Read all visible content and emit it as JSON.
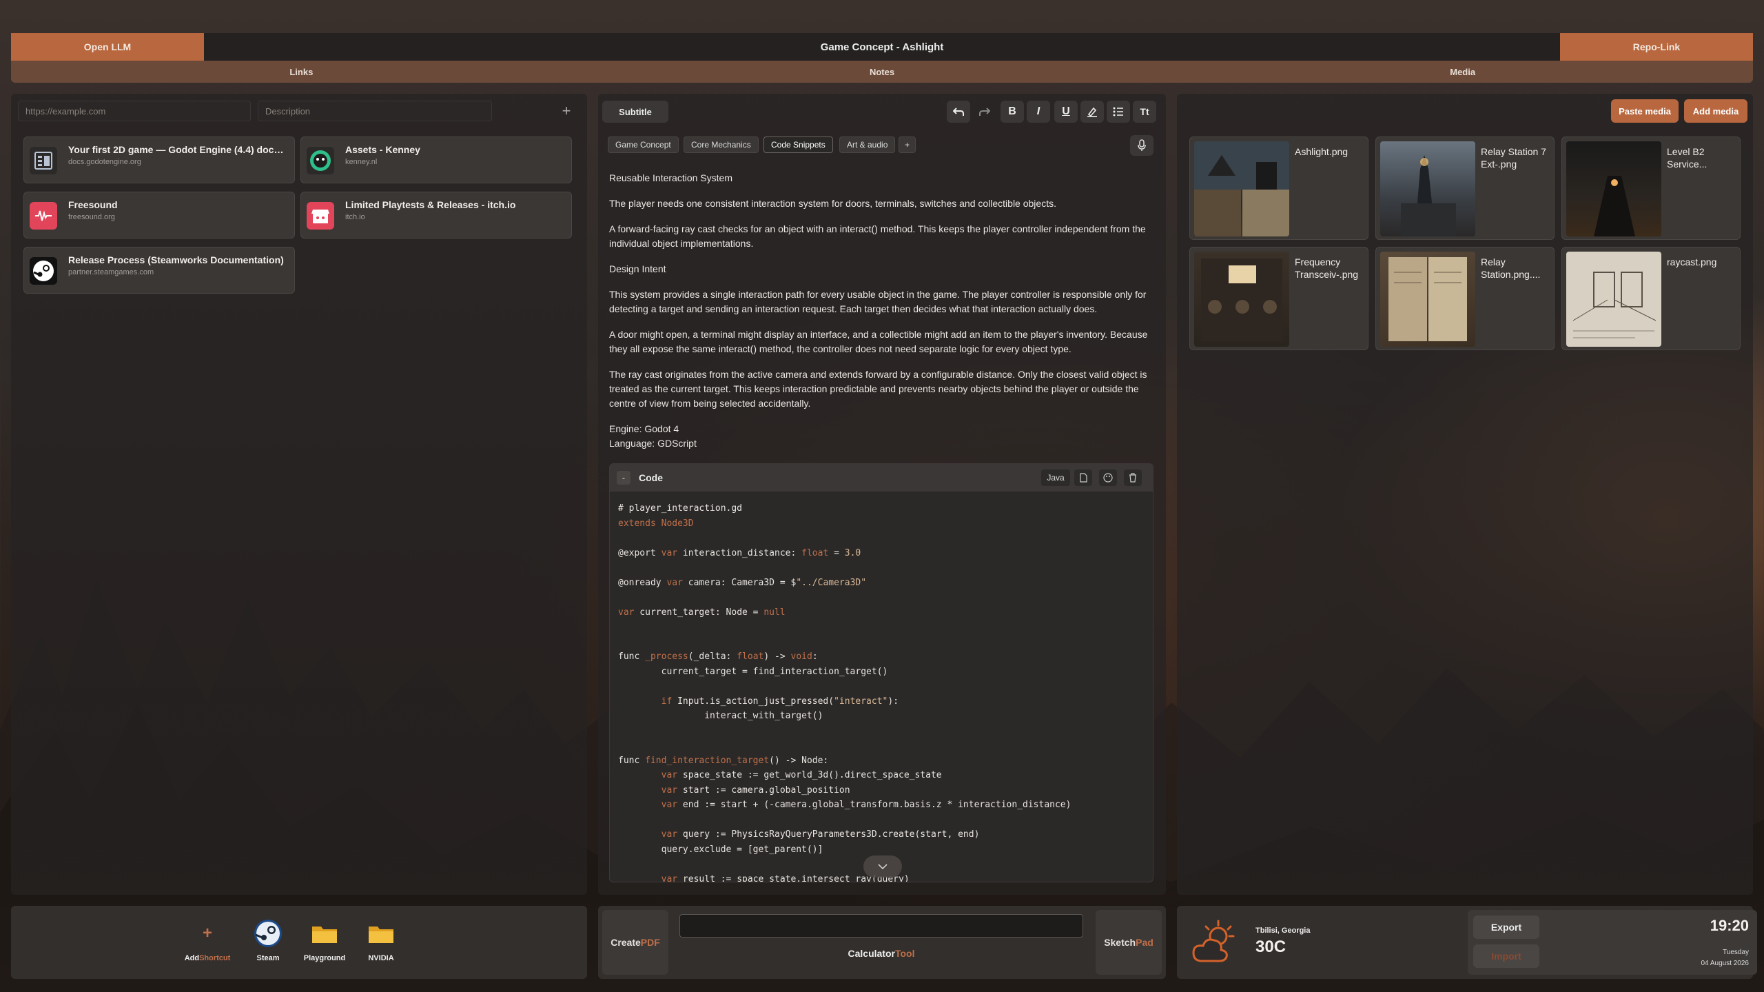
{
  "topbar": {
    "left_button": "Open LLM",
    "title": "Game Concept - Ashlight",
    "right_button": "Repo-Link"
  },
  "sections": {
    "links": "Links",
    "notes": "Notes",
    "media": "Media"
  },
  "links_panel": {
    "url_placeholder": "https://example.com",
    "description_placeholder": "Description",
    "cards": [
      {
        "title": "Your first 2D game — Godot Engine (4.4) docum...",
        "domain": "docs.godotengine.org"
      },
      {
        "title": "Assets - Kenney",
        "domain": "kenney.nl"
      },
      {
        "title": "Freesound",
        "domain": "freesound.org"
      },
      {
        "title": "Limited Playtests & Releases - itch.io",
        "domain": "itch.io"
      },
      {
        "title": "Release Process (Steamworks Documentation)",
        "domain": "partner.steamgames.com"
      }
    ]
  },
  "notes_panel": {
    "style_select": "Subtitle",
    "toolbar": {
      "bold": "B",
      "italic": "I",
      "underline": "U",
      "text_size": "Tt"
    },
    "tags": [
      "Game Concept",
      "Core Mechanics",
      "Code Snippets",
      "Art & audio"
    ],
    "add_tag": "+",
    "active_tag": "Code Snippets",
    "paragraphs": [
      "Reusable Interaction System",
      "The player needs one consistent interaction system for doors, terminals, switches and collectible objects.",
      "A forward-facing ray cast checks for an object with an interact() method. This keeps the player controller independent from the individual object implementations.",
      "Design Intent",
      "This system provides a single interaction path for every usable object in the game. The player controller is responsible only for detecting a target and sending an interaction request. Each target then decides what that interaction actually does.",
      "A door might open, a terminal might display an interface, and a collectible might add an item to the player's inventory. Because they all expose the same interact() method, the controller does not need separate logic for every object type.",
      "The ray cast originates from the active camera and extends forward by a configurable distance. Only the closest valid object is treated as the current target. This keeps interaction predictable and prevents nearby objects behind the player or outside the centre of view from being selected accidentally."
    ],
    "engine_line": "Engine: Godot 4",
    "language_line": "Language: GDScript",
    "code_block": {
      "title": "Code",
      "collapse": "-",
      "language": "Java"
    }
  },
  "media_panel": {
    "paste_button": "Paste media",
    "add_button": "Add media",
    "items": [
      {
        "name": "Ashlight.png"
      },
      {
        "name": "Relay Station 7 Ext-.png"
      },
      {
        "name": "Level B2 Service..."
      },
      {
        "name": "Frequency Transceiv-.png"
      },
      {
        "name": "Relay Station.png...."
      },
      {
        "name": "raycast.png"
      }
    ]
  },
  "shortcuts": {
    "add_label_a": "Add",
    "add_label_b": "Shortcut",
    "items": [
      {
        "label": "Steam",
        "icon": "steam-icon"
      },
      {
        "label": "Playground",
        "icon": "folder-icon"
      },
      {
        "label": "NVIDIA",
        "icon": "folder-icon"
      }
    ]
  },
  "tools": {
    "create_a": "Create",
    "create_b": "PDF",
    "calc_a": "Calculator",
    "calc_b": "Tool",
    "sketch_a": "Sketch",
    "sketch_b": "Pad"
  },
  "weather": {
    "location": "Tbilisi, Georgia",
    "temperature": "30C",
    "icon": "partly-cloudy-icon"
  },
  "data_buttons": {
    "export": "Export",
    "import": "Import"
  },
  "clock": {
    "time": "19:20",
    "weekday": "Tuesday",
    "date": "04 August 2026"
  },
  "colors": {
    "accent": "#b8673e",
    "orange_text": "#c0704a",
    "panel": "#262322"
  }
}
